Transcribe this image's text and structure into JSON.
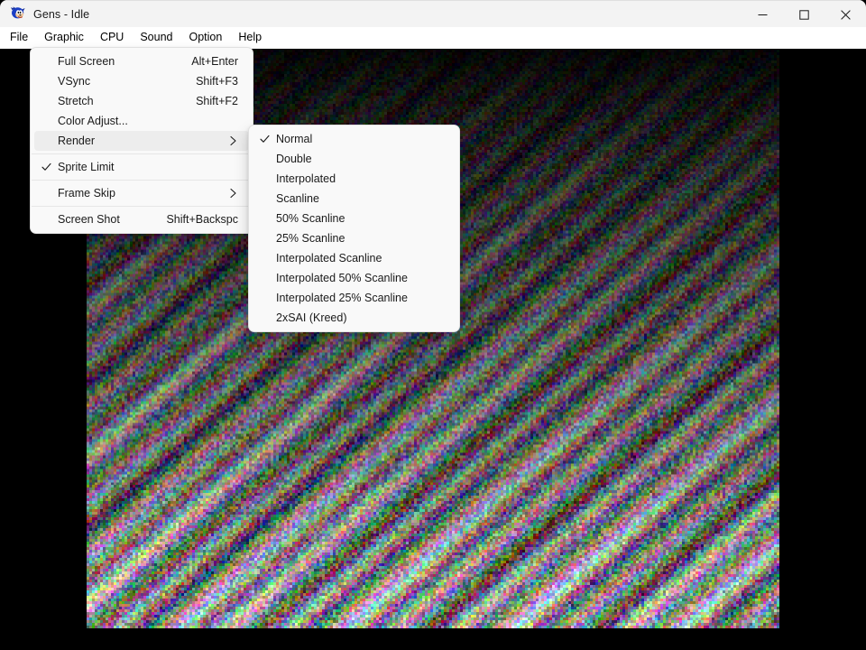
{
  "window": {
    "title": "Gens - Idle",
    "app_icon": "sonic-app-icon",
    "controls": [
      {
        "name": "minimize",
        "glyph": "—"
      },
      {
        "name": "maximize",
        "glyph": "□"
      },
      {
        "name": "close",
        "glyph": "✕"
      }
    ]
  },
  "menubar": {
    "items": [
      {
        "label": "File",
        "name": "menubar-item-file"
      },
      {
        "label": "Graphic",
        "name": "menubar-item-graphic"
      },
      {
        "label": "CPU",
        "name": "menubar-item-cpu"
      },
      {
        "label": "Sound",
        "name": "menubar-item-sound"
      },
      {
        "label": "Option",
        "name": "menubar-item-option"
      },
      {
        "label": "Help",
        "name": "menubar-item-help"
      }
    ]
  },
  "graphic_menu": {
    "items": [
      {
        "label": "Full Screen",
        "accel": "Alt+Enter",
        "checked": false,
        "submenu": false
      },
      {
        "label": "VSync",
        "accel": "Shift+F3",
        "checked": false,
        "submenu": false
      },
      {
        "label": "Stretch",
        "accel": "Shift+F2",
        "checked": false,
        "submenu": false
      },
      {
        "label": "Color Adjust...",
        "accel": "",
        "checked": false,
        "submenu": false
      },
      {
        "label": "Render",
        "accel": "",
        "checked": false,
        "submenu": true,
        "highlighted": true
      },
      {
        "label": "Sprite Limit",
        "accel": "",
        "checked": true,
        "submenu": false
      },
      {
        "label": "Frame Skip",
        "accel": "",
        "checked": false,
        "submenu": true
      },
      {
        "label": "Screen Shot",
        "accel": "Shift+Backspc",
        "checked": false,
        "submenu": false
      }
    ]
  },
  "render_submenu": {
    "items": [
      {
        "label": "Normal",
        "checked": true
      },
      {
        "label": "Double",
        "checked": false
      },
      {
        "label": "Interpolated",
        "checked": false
      },
      {
        "label": "Scanline",
        "checked": false
      },
      {
        "label": "50% Scanline",
        "checked": false
      },
      {
        "label": "25% Scanline",
        "checked": false
      },
      {
        "label": "Interpolated Scanline",
        "checked": false
      },
      {
        "label": "Interpolated 50% Scanline",
        "checked": false
      },
      {
        "label": "Interpolated 25% Scanline",
        "checked": false
      },
      {
        "label": "2xSAI (Kreed)",
        "checked": false
      }
    ]
  },
  "canvas": {
    "name": "emulator-video-output",
    "description": "noise-pattern-diagonal-stripes"
  },
  "colors": {
    "titlebar_bg": "#f3f3f3",
    "menubar_bg": "#ffffff",
    "flyout_bg": "#f9f9f9",
    "flyout_border": "#e0e0e0",
    "highlight_bg": "#ededed",
    "text": "#1a1a1a",
    "separator": "#e6e6e6",
    "canvas_bg": "#000000"
  }
}
